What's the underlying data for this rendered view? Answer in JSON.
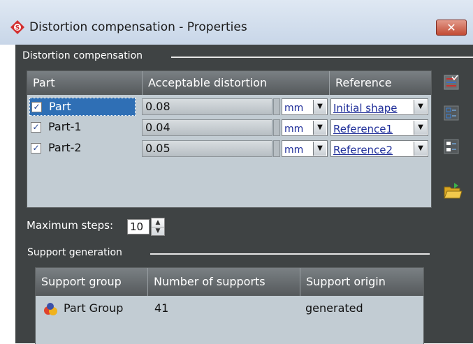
{
  "window": {
    "title": "Distortion compensation - Properties",
    "close_glyph": "✕"
  },
  "distortion_section": {
    "label": "Distortion compensation"
  },
  "parts_table": {
    "columns": [
      "Part",
      "Acceptable distortion",
      "Reference"
    ],
    "rows": [
      {
        "checked": true,
        "name": "Part",
        "distortion": "0.08",
        "unit": "mm",
        "reference": "Initial shape"
      },
      {
        "checked": true,
        "name": "Part-1",
        "distortion": "0.04",
        "unit": "mm",
        "reference": "Reference1"
      },
      {
        "checked": true,
        "name": "Part-2",
        "distortion": "0.05",
        "unit": "mm",
        "reference": "Reference2"
      }
    ]
  },
  "side_tools": [
    "check-all-icon",
    "uncheck-all-icon",
    "invert-check-icon",
    "open-folder-icon"
  ],
  "max_steps": {
    "label": "Maximum steps:",
    "value": "10"
  },
  "support_section": {
    "label": "Support generation"
  },
  "support_table": {
    "columns": [
      "Support group",
      "Number of supports",
      "Support origin"
    ],
    "rows": [
      {
        "group": "Part Group",
        "count": "41",
        "origin": "generated"
      }
    ]
  },
  "colors": {
    "panel_bg": "#3f4344",
    "grid_bg": "#c2ccd3",
    "selection": "#2f6fb5",
    "title_bar": "#d4e0ee",
    "close": "#c24b34"
  }
}
